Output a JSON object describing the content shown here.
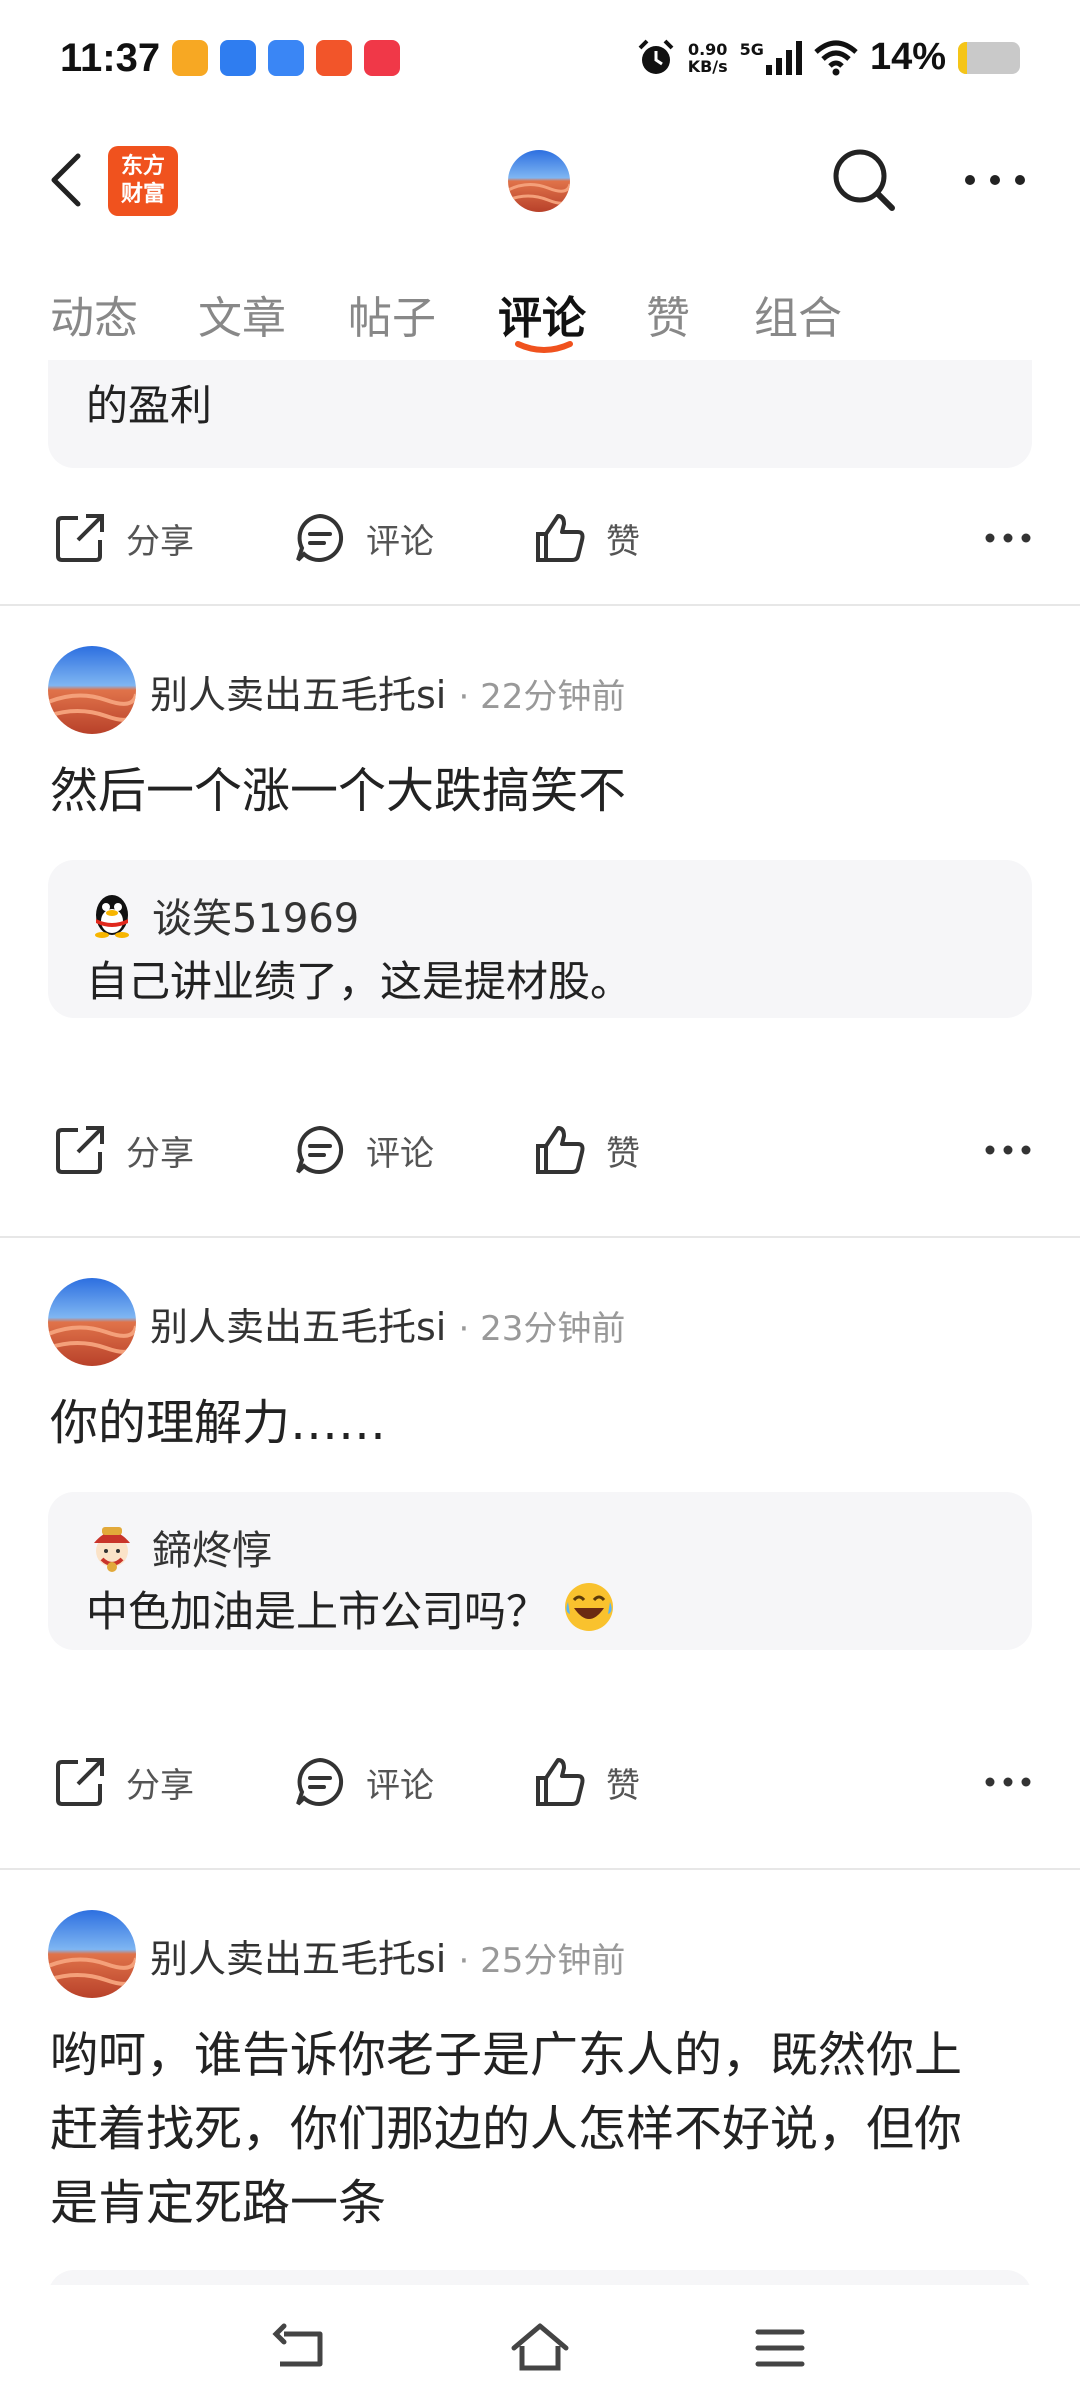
{
  "status_bar": {
    "time": "11:37",
    "net_speed_value": "0.90",
    "net_speed_unit": "KB/s",
    "network": "5G",
    "battery_percent": "14%",
    "battery_level": 0.14,
    "app_icon_colors": [
      "#f7a823",
      "#2f7df0",
      "#3a86f5",
      "#f2552a",
      "#f03848"
    ]
  },
  "header": {
    "brand_logo_text": "东方财富",
    "icons": [
      "back-arrow-icon",
      "search-icon",
      "more-icon"
    ]
  },
  "tabs": [
    {
      "label": "动态",
      "active": false
    },
    {
      "label": "文章",
      "active": false
    },
    {
      "label": "帖子",
      "active": false
    },
    {
      "label": "评论",
      "active": true
    },
    {
      "label": "赞",
      "active": false
    },
    {
      "label": "组合",
      "active": false
    }
  ],
  "actions": {
    "share": "分享",
    "comment": "评论",
    "like": "赞"
  },
  "feed": {
    "partial_quote_text": "的盈利",
    "posts": [
      {
        "user": "别人卖出五毛托si",
        "time": "22分钟前",
        "text": "然后一个涨一个大跌搞笑不",
        "quote_user": "谈笑51969",
        "quote_text": "自己讲业绩了，这是提材股。"
      },
      {
        "user": "别人卖出五毛托si",
        "time": "23分钟前",
        "text": "你的理解力……",
        "quote_user": "鍗炵惇",
        "quote_text": "中色加油是上市公司吗？"
      },
      {
        "user": "别人卖出五毛托si",
        "time": "25分钟前",
        "text_lines": [
          "哟呵，谁告诉你老子是广东人的，既然你上",
          "赶着找死，你们那边的人怎样不好说，但你",
          "是肯定死路一条"
        ]
      }
    ]
  },
  "colors": {
    "accent": "#f0521e",
    "quote_bg": "#f6f6f8"
  }
}
